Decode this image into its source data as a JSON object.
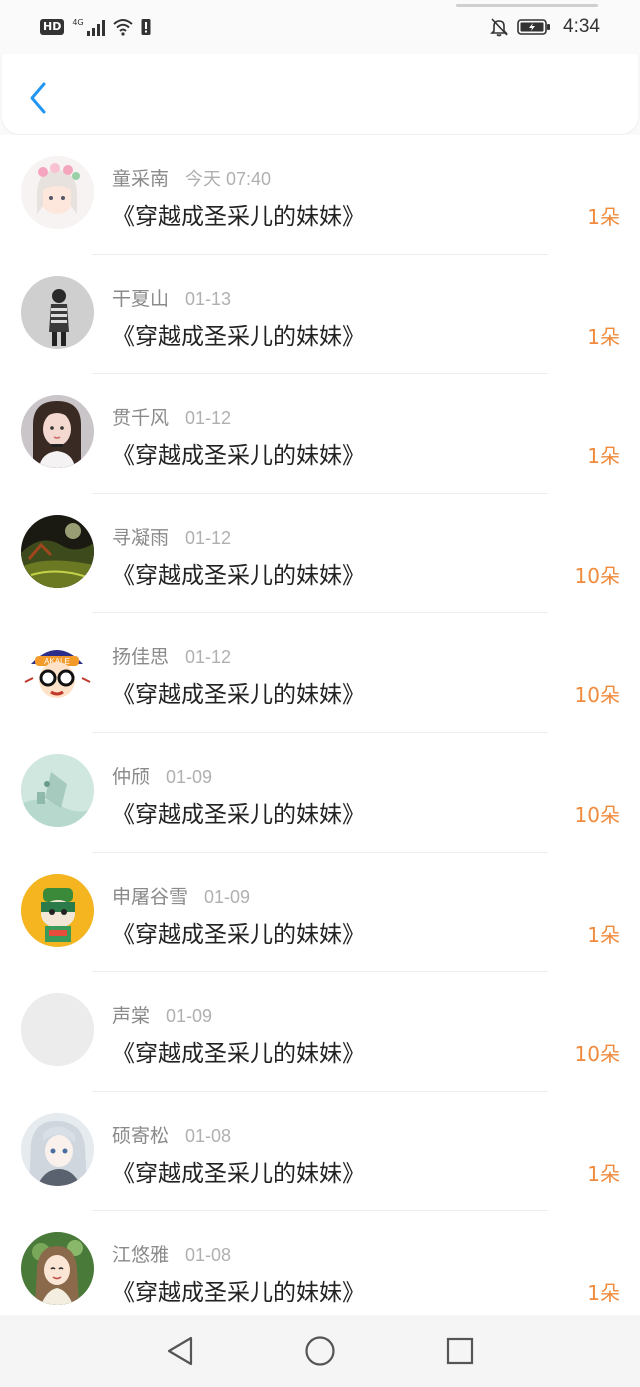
{
  "status_bar": {
    "hd": "HD",
    "network": "4G",
    "time": "4:34",
    "icons": [
      "signal-icon",
      "wifi-icon",
      "alert-icon",
      "bell-off-icon",
      "battery-icon"
    ]
  },
  "header": {
    "back_icon": "chevron-left-icon",
    "accent_color": "#2196f3"
  },
  "colors": {
    "count": "#f08a3c",
    "name": "#8a8a8a",
    "date": "#b0b0b0",
    "title": "#222222"
  },
  "items": [
    {
      "name": "童采南",
      "date": "今天 07:40",
      "title": "《穿越成圣采儿的妹妹》",
      "count": "1朵",
      "avatar": "anime-girl-flowers"
    },
    {
      "name": "干夏山",
      "date": "01-13",
      "title": "《穿越成圣采儿的妹妹》",
      "count": "1朵",
      "avatar": "grayscale-person"
    },
    {
      "name": "贯千风",
      "date": "01-12",
      "title": "《穿越成圣采儿的妹妹》",
      "count": "1朵",
      "avatar": "girl-portrait"
    },
    {
      "name": "寻凝雨",
      "date": "01-12",
      "title": "《穿越成圣采儿的妹妹》",
      "count": "10朵",
      "avatar": "landscape-planet"
    },
    {
      "name": "扬佳思",
      "date": "01-12",
      "title": "《穿越成圣采儿的妹妹》",
      "count": "10朵",
      "avatar": "cartoon-glasses"
    },
    {
      "name": "仲颀",
      "date": "01-09",
      "title": "《穿越成圣采儿的妹妹》",
      "count": "10朵",
      "avatar": "mint-abstract"
    },
    {
      "name": "申屠谷雪",
      "date": "01-09",
      "title": "《穿越成圣采儿的妹妹》",
      "count": "1朵",
      "avatar": "cartoon-yellow"
    },
    {
      "name": "声棠",
      "date": "01-09",
      "title": "《穿越成圣采儿的妹妹》",
      "count": "10朵",
      "avatar": "blank"
    },
    {
      "name": "硕寄松",
      "date": "01-08",
      "title": "《穿越成圣采儿的妹妹》",
      "count": "1朵",
      "avatar": "anime-silver-hair"
    },
    {
      "name": "江悠雅",
      "date": "01-08",
      "title": "《穿越成圣采儿的妹妹》",
      "count": "1朵",
      "avatar": "anime-girl-green"
    }
  ],
  "system_nav": [
    "back-triangle-icon",
    "home-circle-icon",
    "recents-square-icon"
  ]
}
